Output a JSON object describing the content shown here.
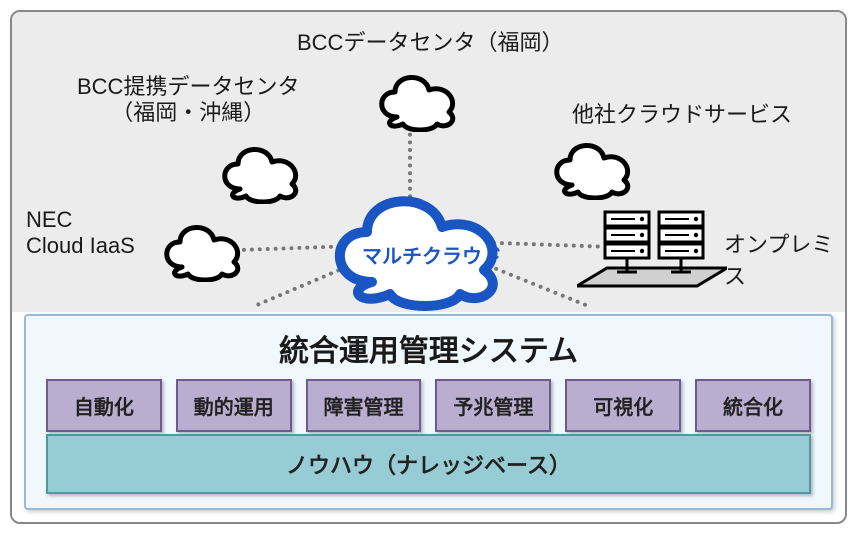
{
  "top": {
    "bcc_datacenter": "BCCデータセンタ（福岡）",
    "bcc_partner_line1": "BCC提携データセンタ",
    "bcc_partner_line2": "（福岡・沖縄）",
    "other_cloud": "他社クラウドサービス",
    "nec_line1": "NEC",
    "nec_line2": "Cloud IaaS",
    "onpremise": "オンプレミス",
    "center_cloud": "マルチクラウド"
  },
  "panel": {
    "title": "統合運用管理システム",
    "features": [
      "自動化",
      "動的運用",
      "障害管理",
      "予兆管理",
      "可視化",
      "統合化"
    ],
    "knowhow": "ノウハウ（ナレッジベース）"
  }
}
